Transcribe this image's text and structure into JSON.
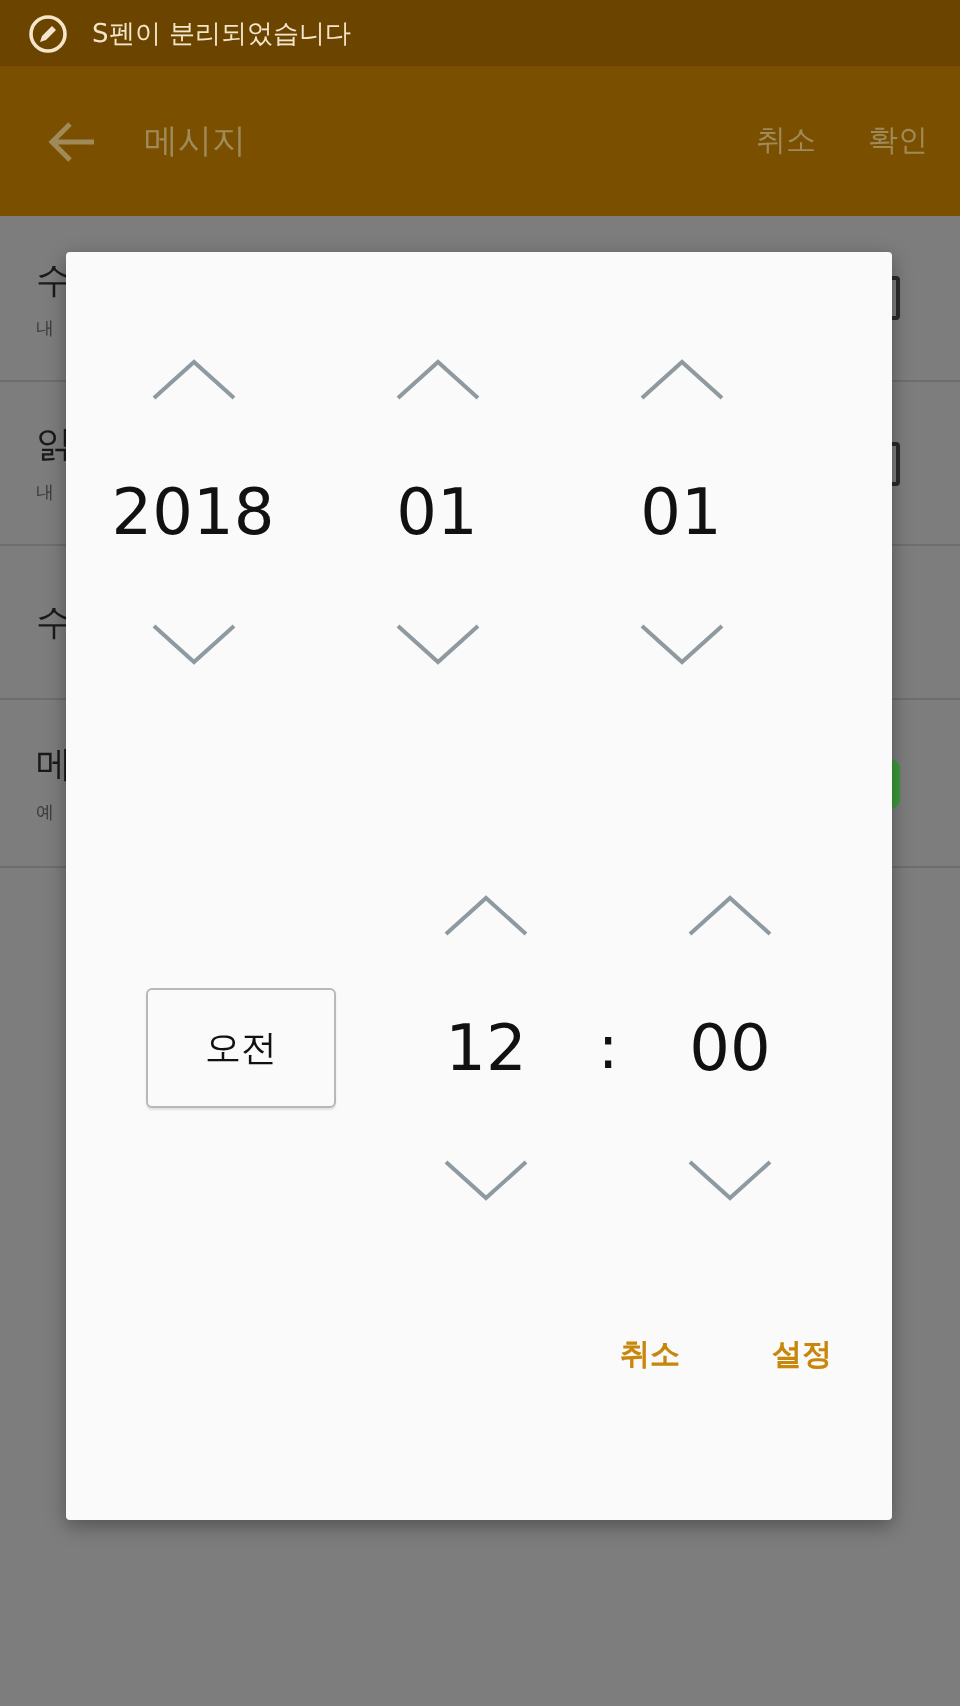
{
  "status_bar": {
    "notification": "S펜이 분리되었습니다"
  },
  "app_bar": {
    "title": "메시지",
    "actions": [
      "취소",
      "확인"
    ]
  },
  "settings": [
    {
      "title": "수",
      "subtitle": "내",
      "kind": "checkbox",
      "checked": false
    },
    {
      "title": "읽",
      "subtitle": "내",
      "kind": "checkbox",
      "checked": false
    },
    {
      "title": "수",
      "kind": "plain"
    },
    {
      "title": "메",
      "subtitle": "예",
      "kind": "switch",
      "on": true
    }
  ],
  "dialog": {
    "date": [
      "2018",
      "01",
      "01"
    ],
    "period": "오전",
    "time": [
      "12",
      "00"
    ],
    "separator": ":",
    "buttons": [
      "취소",
      "설정"
    ]
  }
}
